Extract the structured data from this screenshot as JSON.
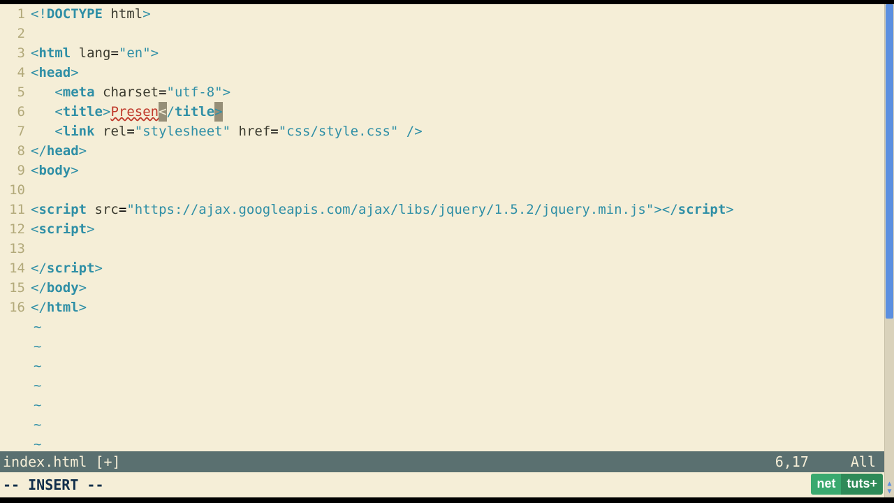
{
  "editor": {
    "lines": [
      {
        "n": "1",
        "html": "<span class='br'>&lt;!</span><span class='kw'>DOCTYPE</span> <span class='attr'>html</span><span class='br'>&gt;</span>"
      },
      {
        "n": "2",
        "html": ""
      },
      {
        "n": "3",
        "html": "<span class='br'>&lt;</span><span class='kw'>html</span> <span class='attr'>lang</span>=<span class='str'>\"en\"</span><span class='br'>&gt;</span>"
      },
      {
        "n": "4",
        "html": "<span class='br'>&lt;</span><span class='kw'>head</span><span class='br'>&gt;</span>"
      },
      {
        "n": "5",
        "html": "   <span class='br'>&lt;</span><span class='kw'>meta</span> <span class='attr'>charset</span>=<span class='str'>\"utf-8\"</span><span class='br'>&gt;</span>"
      },
      {
        "n": "6",
        "html": "   <span class='br'>&lt;</span><span class='kw'>title</span><span class='br'>&gt;</span><span class='err'>Presen</span><span class='cursorbox'>&lt;</span><span class='br'>/</span><span class='kw'>title</span><span class='matchbox'>&gt;</span>"
      },
      {
        "n": "7",
        "html": "   <span class='br'>&lt;</span><span class='kw'>link</span> <span class='attr'>rel</span>=<span class='str'>\"stylesheet\"</span> <span class='attr'>href</span>=<span class='str'>\"css/style.css\"</span> <span class='br'>/&gt;</span>"
      },
      {
        "n": "8",
        "html": "<span class='br'>&lt;/</span><span class='kw'>head</span><span class='br'>&gt;</span>"
      },
      {
        "n": "9",
        "html": "<span class='br'>&lt;</span><span class='kw'>body</span><span class='br'>&gt;</span>"
      },
      {
        "n": "10",
        "html": ""
      },
      {
        "n": "11",
        "html": "<span class='br'>&lt;</span><span class='kw'>script</span> <span class='attr'>src</span>=<span class='str'>\"https://ajax.googleapis.com/ajax/libs/jquery/1.5.2/jquery.min.js\"</span><span class='br'>&gt;&lt;/</span><span class='kw'>script</span><span class='br'>&gt;</span>"
      },
      {
        "n": "12",
        "html": "<span class='br'>&lt;</span><span class='kw'>script</span><span class='br'>&gt;</span>"
      },
      {
        "n": "13",
        "html": ""
      },
      {
        "n": "14",
        "html": "<span class='br'>&lt;/</span><span class='kw'>script</span><span class='br'>&gt;</span>"
      },
      {
        "n": "15",
        "html": "<span class='br'>&lt;/</span><span class='kw'>body</span><span class='br'>&gt;</span>"
      },
      {
        "n": "16",
        "html": "<span class='br'>&lt;/</span><span class='kw'>html</span><span class='br'>&gt;</span>"
      }
    ],
    "tilde_count": 7,
    "tilde_char": "~"
  },
  "status": {
    "filename": "index.html [+]",
    "position": "6,17",
    "scroll": "All"
  },
  "mode": "-- INSERT --",
  "logo": {
    "left": "net",
    "right": "tuts+"
  }
}
